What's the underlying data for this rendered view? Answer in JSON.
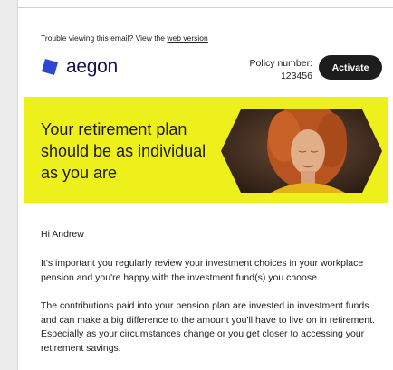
{
  "preheader": {
    "text": "Trouble viewing this email? View the",
    "link": "web version"
  },
  "brand": {
    "name": "aegon",
    "logo_icon": "aegon-logo-mark",
    "color": "#2b45d6"
  },
  "policy": {
    "label": "Policy number:",
    "number": "123456"
  },
  "activate_label": "Activate",
  "hero": {
    "headline": "Your retirement plan should be as individual as you are",
    "background": "#eef01c"
  },
  "body": {
    "greeting": "Hi Andrew",
    "paragraphs": [
      "It's important you regularly review your investment choices in your workplace pension and you're happy with the investment fund(s) you choose.",
      "The contributions paid into your pension plan are invested in investment funds and can make a big difference to the amount you'll have to live on in retirement. Especially as your circumstances change or you get closer to accessing your retirement savings."
    ]
  }
}
